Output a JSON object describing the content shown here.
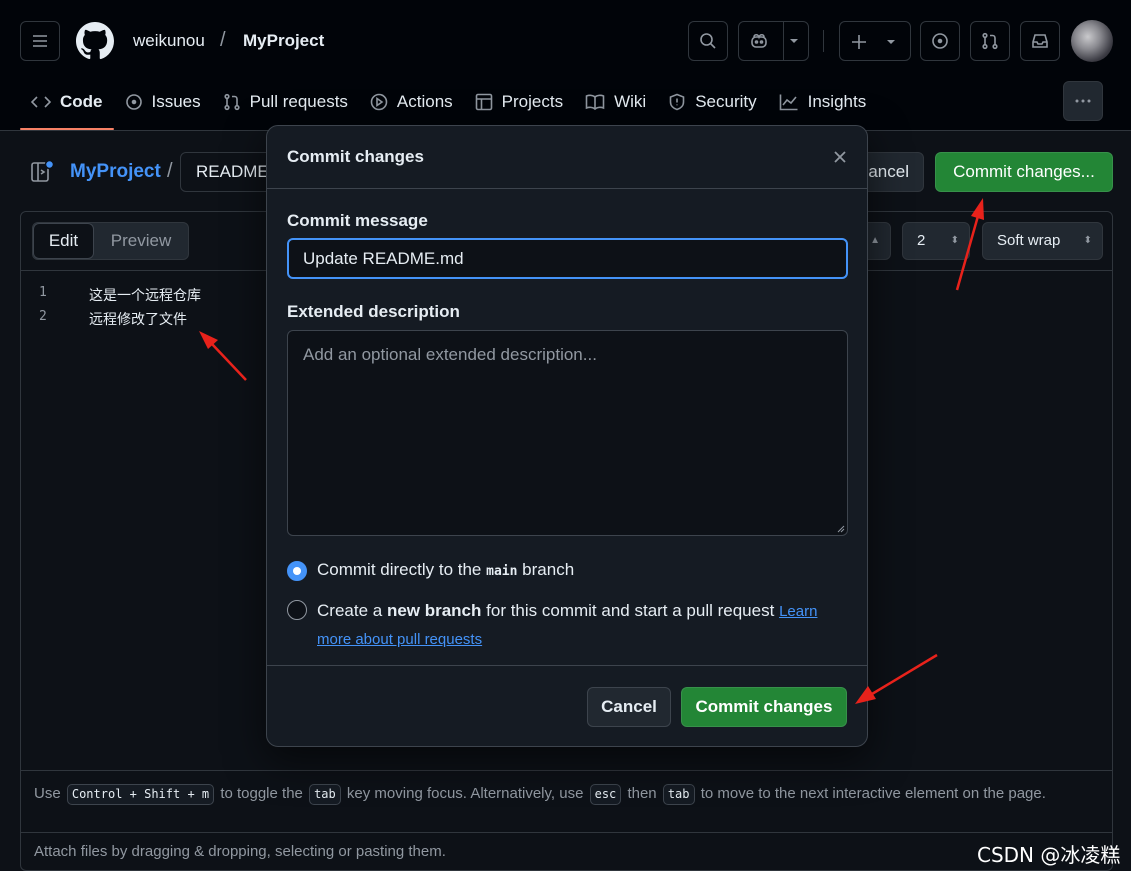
{
  "header": {
    "owner": "weikunou",
    "separator": "/",
    "repo": "MyProject"
  },
  "tabs": [
    {
      "label": "Code",
      "icon": "code-icon"
    },
    {
      "label": "Issues",
      "icon": "issue-opened-icon"
    },
    {
      "label": "Pull requests",
      "icon": "git-pull-request-icon"
    },
    {
      "label": "Actions",
      "icon": "play-icon"
    },
    {
      "label": "Projects",
      "icon": "table-icon"
    },
    {
      "label": "Wiki",
      "icon": "book-icon"
    },
    {
      "label": "Security",
      "icon": "shield-icon"
    },
    {
      "label": "Insights",
      "icon": "graph-icon"
    }
  ],
  "breadcrumb": {
    "repo": "MyProject",
    "separator": "/",
    "file": "README.md",
    "cancel_label": "Cancel changes",
    "commit_label": "Commit changes..."
  },
  "editor": {
    "edit_label": "Edit",
    "preview_label": "Preview",
    "indent_size": "2",
    "wrap_mode": "Soft wrap",
    "lines": [
      {
        "num": "1",
        "text": "这是一个远程仓库"
      },
      {
        "num": "2",
        "text": "远程修改了文件"
      }
    ],
    "hint_1": "Use",
    "hint_kbd1": "Control + Shift + m",
    "hint_2": "to toggle the",
    "hint_kbd2": "tab",
    "hint_3": "key moving focus. Alternatively, use",
    "hint_kbd3": "esc",
    "hint_4": "then",
    "hint_kbd4": "tab",
    "hint_5": "to move to the next interactive element on the page.",
    "attach": "Attach files by dragging & dropping, selecting or pasting them."
  },
  "dialog": {
    "title": "Commit changes",
    "message_label": "Commit message",
    "message_value": "Update README.md",
    "description_label": "Extended description",
    "description_placeholder": "Add an optional extended description...",
    "option1_pre": "Commit directly to the",
    "option1_branch": "main",
    "option1_post": "branch",
    "option2_pre": "Create a",
    "option2_bold": "new branch",
    "option2_post": "for this commit and start a pull request",
    "option2_link": "Learn more about pull requests",
    "cancel_label": "Cancel",
    "commit_label": "Commit changes"
  },
  "watermark": "CSDN @冰凌糕",
  "colors": {
    "accent_green": "#238636",
    "accent_blue": "#4493f8",
    "annotation_red": "#e8221b"
  }
}
